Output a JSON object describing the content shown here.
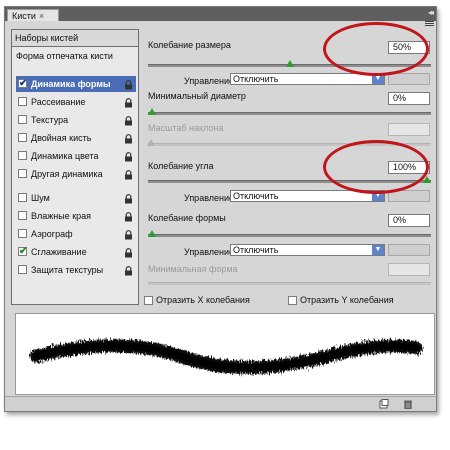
{
  "panel": {
    "tab_label": "Кисти",
    "tab_close": "×",
    "collapse_glyph": "◂◂"
  },
  "left": {
    "presets_label": "Наборы кистей",
    "tip_shape_label": "Форма отпечатка кисти",
    "categories": [
      {
        "label": "Динамика формы",
        "checked": true,
        "selected": true,
        "lock": true
      },
      {
        "label": "Рассеивание",
        "checked": false,
        "selected": false,
        "lock": true
      },
      {
        "label": "Текстура",
        "checked": false,
        "selected": false,
        "lock": true
      },
      {
        "label": "Двойная кисть",
        "checked": false,
        "selected": false,
        "lock": true
      },
      {
        "label": "Динамика цвета",
        "checked": false,
        "selected": false,
        "lock": true
      },
      {
        "label": "Другая динамика",
        "checked": false,
        "selected": false,
        "lock": true
      },
      {
        "label": "Шум",
        "checked": false,
        "selected": false,
        "lock": true
      },
      {
        "label": "Влажные края",
        "checked": false,
        "selected": false,
        "lock": true
      },
      {
        "label": "Аэрограф",
        "checked": false,
        "selected": false,
        "lock": true
      },
      {
        "label": "Сглаживание",
        "checked": true,
        "selected": false,
        "lock": true
      },
      {
        "label": "Защита текстуры",
        "checked": false,
        "selected": false,
        "lock": true
      }
    ]
  },
  "right": {
    "size_jitter": {
      "label": "Колебание размера",
      "value": "50%",
      "slider_fraction": 0.5
    },
    "control1": {
      "label": "Управление:",
      "value": "Отключить"
    },
    "min_diameter": {
      "label": "Минимальный диаметр",
      "value": "0%",
      "slider_fraction": 0
    },
    "tilt_scale": {
      "label": "Масштаб наклона",
      "value": ""
    },
    "angle_jitter": {
      "label": "Колебание угла",
      "value": "100%",
      "slider_fraction": 1
    },
    "control2": {
      "label": "Управление:",
      "value": "Отключить"
    },
    "roundness_jitter": {
      "label": "Колебание формы",
      "value": "0%",
      "slider_fraction": 0
    },
    "control3": {
      "label": "Управление:",
      "value": "Отключить"
    },
    "min_roundness": {
      "label": "Минимальная форма",
      "value": ""
    }
  },
  "options": {
    "flip_x": "Отразить X колебания",
    "flip_y": "Отразить Y колебания"
  },
  "colors": {
    "highlight": "#4a6db6",
    "annotation_ring": "#c0161b",
    "slider_thumb": "#2f9c2f"
  }
}
